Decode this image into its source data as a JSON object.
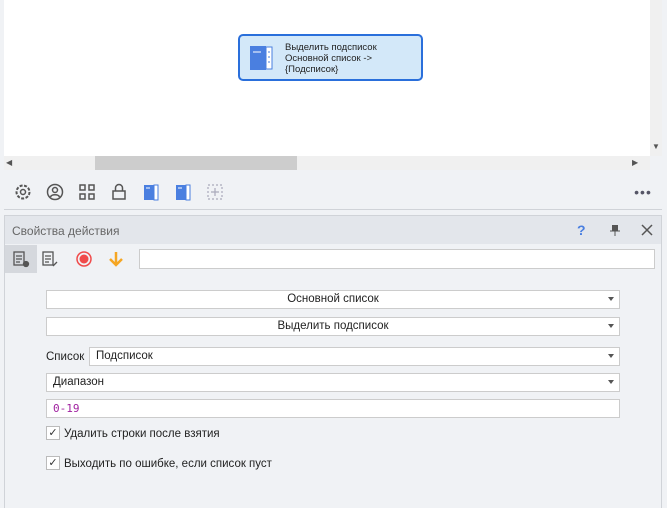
{
  "node": {
    "lines": [
      "Выделить подсписок",
      "Основной список ->",
      "{Подсписок}"
    ]
  },
  "panel": {
    "title": "Свойства действия",
    "help": "?",
    "search_value": ""
  },
  "form": {
    "list_select": "Основной список",
    "action_select": "Выделить подсписок",
    "target_label": "Список",
    "target_select": "Подсписок",
    "mode_select": "Диапазон",
    "range_value": "0-19",
    "delete_rows_label": "Удалить строки после взятия",
    "delete_rows_checked": true,
    "exit_on_error_label": "Выходить по ошибке, если список пуст",
    "exit_on_error_checked": true,
    "check_mark": "✓"
  },
  "colors": {
    "accent": "#2a6fdb",
    "node_bg": "#d3e8f9",
    "record": "#f04a4a",
    "arrow": "#f5a623",
    "range_text": "#a020a0"
  }
}
